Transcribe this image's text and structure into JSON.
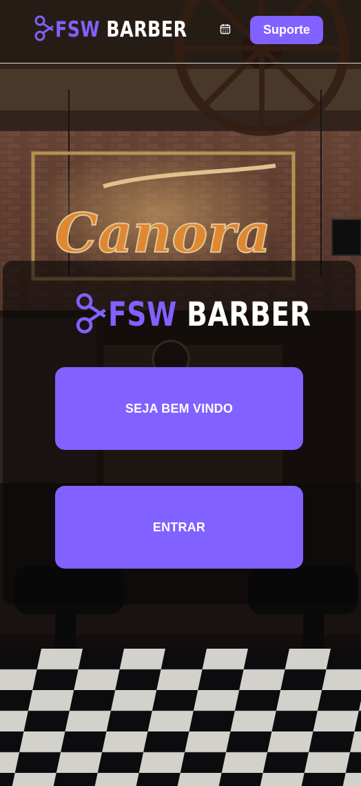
{
  "header": {
    "logo_icon": "scissors-icon",
    "brand_accent": "FSW",
    "brand_name": "BARBER",
    "calendar_icon": "calendar-icon",
    "support_label": "Suporte"
  },
  "hero": {
    "neon_sign_text": "Canora"
  },
  "welcome_card": {
    "logo_icon": "scissors-icon",
    "brand_accent": "FSW",
    "brand_name": "BARBER",
    "welcome_label": "SEJA BEM VINDO",
    "enter_label": "ENTRAR"
  },
  "colors": {
    "accent": "#8161ff",
    "text": "#ffffff"
  }
}
